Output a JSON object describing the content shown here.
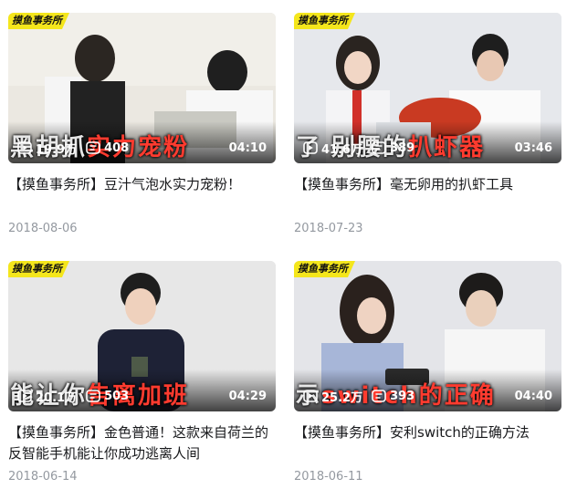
{
  "brand": "摸鱼事务所",
  "cards": [
    {
      "views": "19.9万",
      "danmaku": "408",
      "duration": "04:10",
      "overlay_pre": "黑胡抓",
      "overlay_hl": "实力宠粉",
      "title": "【摸鱼事务所】豆汁气泡水实力宠粉！",
      "date": "2018-08-06",
      "scene_bg": "#e9e6df"
    },
    {
      "views": "41.6万",
      "danmaku": "389",
      "duration": "03:46",
      "overlay_pre": "了 别腰的",
      "overlay_hl": "扒虾器",
      "title": "【摸鱼事务所】毫无卵用的扒虾工具",
      "date": "2018-07-23",
      "scene_bg": "#e4e6ea"
    },
    {
      "views": "20.1万",
      "danmaku": "503",
      "duration": "04:29",
      "overlay_pre": "能让你",
      "overlay_hl": "告离加班",
      "title": "【摸鱼事务所】金色普通！这款来自荷兰的反智能手机能让你成功逃离人间",
      "date": "2018-06-14",
      "scene_bg": "#e6e6e6"
    },
    {
      "views": "25.2万",
      "danmaku": "393",
      "duration": "04:40",
      "overlay_pre": "示",
      "overlay_hl": "switch的正确",
      "title": "【摸鱼事务所】安利switch的正确方法",
      "date": "2018-06-11",
      "scene_bg": "#e3e4e8"
    }
  ]
}
